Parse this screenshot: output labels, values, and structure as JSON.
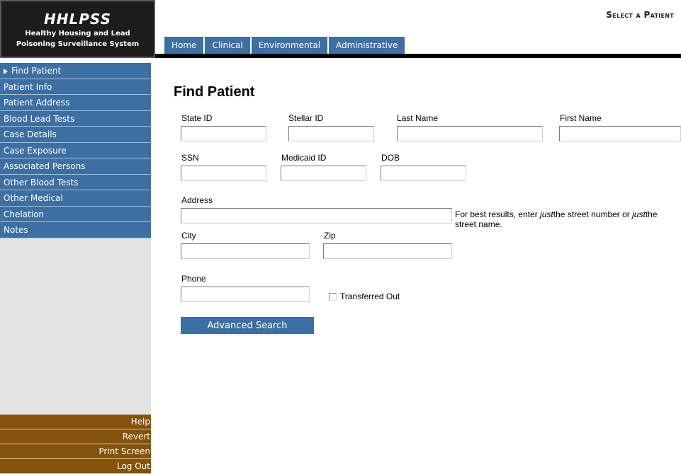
{
  "logo": {
    "title": "HHLPSS",
    "subtitle_line1": "Healthy Housing and Lead",
    "subtitle_line2": "Poisoning Surveillance System"
  },
  "header": {
    "title": "Select a Patient"
  },
  "tabs": [
    {
      "label": "Home"
    },
    {
      "label": "Clinical"
    },
    {
      "label": "Environmental"
    },
    {
      "label": "Administrative"
    }
  ],
  "sidebar": {
    "items": [
      {
        "label": "Find Patient",
        "active": true
      },
      {
        "label": "Patient Info"
      },
      {
        "label": "Patient Address"
      },
      {
        "label": "Blood Lead Tests"
      },
      {
        "label": "Case Details"
      },
      {
        "label": "Case Exposure"
      },
      {
        "label": "Associated Persons"
      },
      {
        "label": "Other Blood Tests"
      },
      {
        "label": "Other Medical"
      },
      {
        "label": "Chelation"
      },
      {
        "label": "Notes"
      }
    ],
    "utilities": [
      {
        "label": "Help"
      },
      {
        "label": "Revert"
      },
      {
        "label": "Print Screen"
      },
      {
        "label": "Log Out"
      }
    ]
  },
  "form": {
    "title": "Find Patient",
    "state_id_label": "State ID",
    "stellar_id_label": "Stellar ID",
    "last_name_label": "Last Name",
    "first_name_label": "First Name",
    "ssn_label": "SSN",
    "medicaid_id_label": "Medicaid ID",
    "dob_label": "DOB",
    "address_label": "Address",
    "address_hint_pre": "For best results, enter ",
    "address_hint_just1": "just",
    "address_hint_mid": "the street number or ",
    "address_hint_just2": "just",
    "address_hint_post": "the street name.",
    "city_label": "City",
    "zip_label": "Zip",
    "phone_label": "Phone",
    "transferred_out_label": "Transferred Out",
    "transferred_out_checked": false,
    "advanced_search_label": "Advanced Search"
  }
}
